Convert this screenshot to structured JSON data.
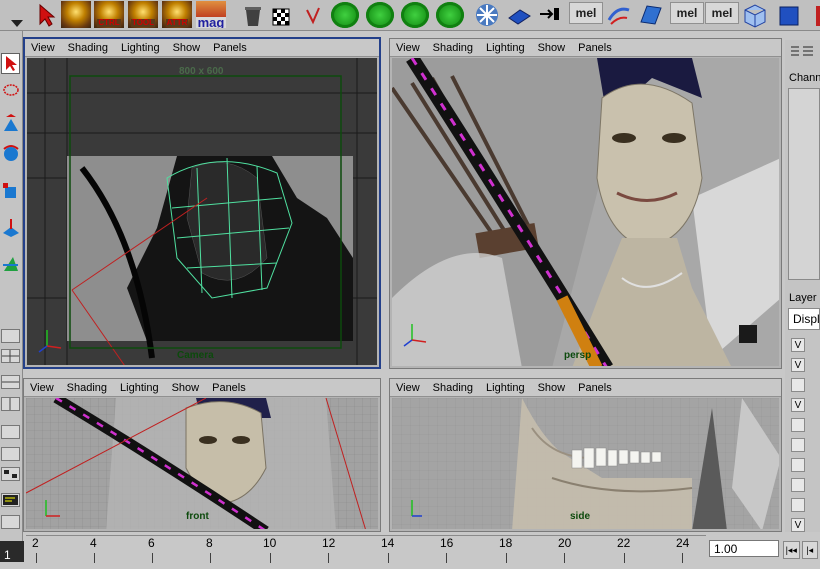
{
  "shelf": {
    "buttons": [
      {
        "label": "",
        "icon": "select-arrow-icon"
      },
      {
        "label": "",
        "icon": "orb-icon"
      },
      {
        "label": "CTRL",
        "icon": "ctrl-orb-icon"
      },
      {
        "label": "TOOL",
        "icon": "tool-orb-icon"
      },
      {
        "label": "ATTR",
        "icon": "attr-orb-icon"
      },
      {
        "label": "mag",
        "icon": "mag-icon"
      }
    ],
    "mel_labels": [
      "mel",
      "mel",
      "mel"
    ]
  },
  "viewport_menu": [
    "View",
    "Shading",
    "Lighting",
    "Show",
    "Panels"
  ],
  "viewports": {
    "camera": {
      "label": "Camera",
      "resolution": "800 x 600"
    },
    "persp": {
      "label": "persp"
    },
    "front": {
      "label": "front"
    },
    "side": {
      "label": "side"
    }
  },
  "right_panel": {
    "channels_header": "Chann",
    "layers_header": "Layer",
    "display_field": "Displ",
    "layer_flags": [
      "V",
      "V",
      "",
      "V",
      "",
      "",
      "",
      "",
      "",
      "V"
    ]
  },
  "timeline": {
    "ticks": [
      "2",
      "4",
      "6",
      "8",
      "10",
      "12",
      "14",
      "16",
      "18",
      "20",
      "22",
      "24"
    ],
    "current_frame": "1",
    "start_field": "1.00"
  },
  "colors": {
    "accent_active_border": "#24408a",
    "camera_gate": "#0c4a0c",
    "viewport_bg": "#b4b4b4"
  }
}
